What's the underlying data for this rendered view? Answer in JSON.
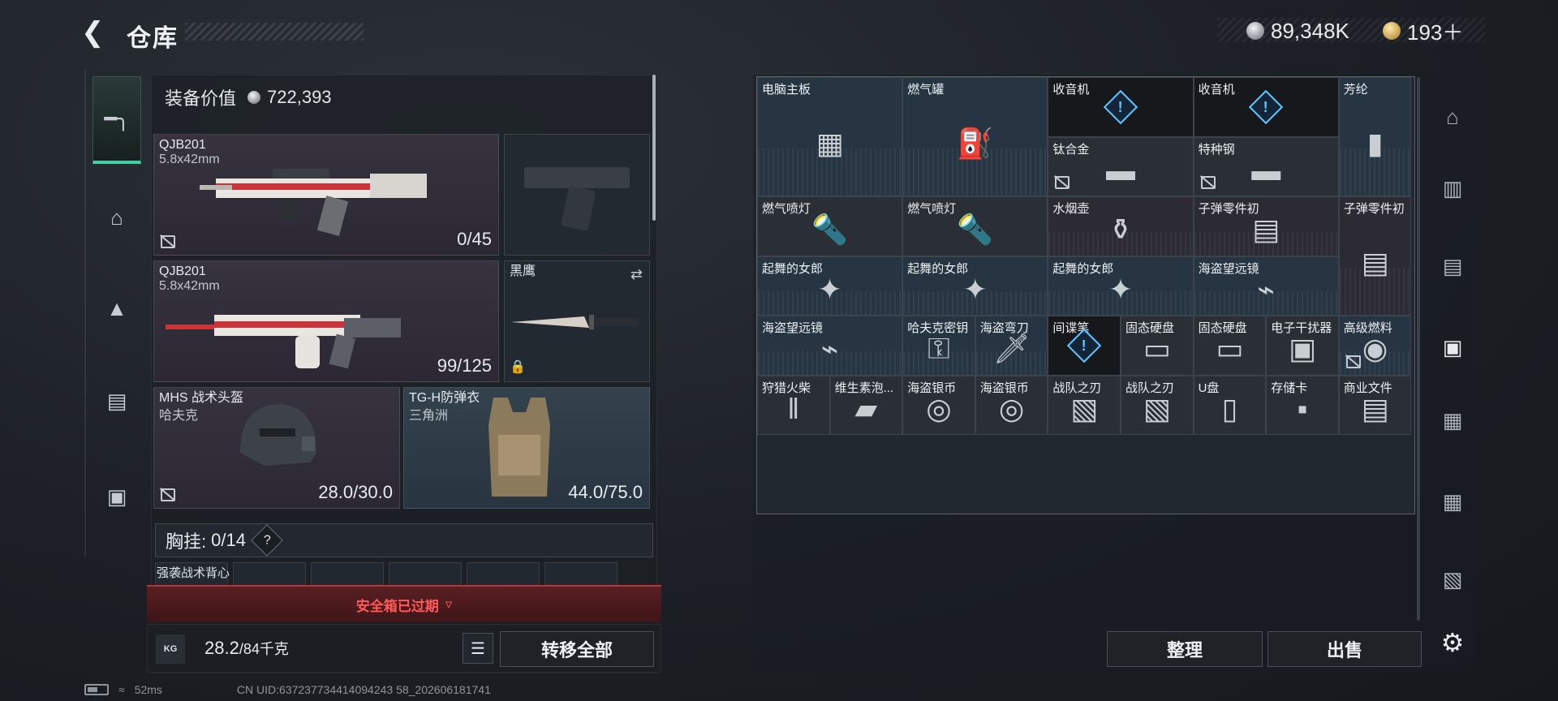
{
  "header": {
    "title": "仓库",
    "currency_silver": "89,348K",
    "currency_gold": "193＋"
  },
  "equipment": {
    "value_label": "装备价值",
    "value": "722,393",
    "primary": {
      "name": "QJB201",
      "caliber": "5.8x42mm",
      "ammo": "0/45"
    },
    "secondary": {
      "name": "QJB201",
      "caliber": "5.8x42mm",
      "ammo": "99/125"
    },
    "melee": {
      "name": "黑鹰"
    },
    "helmet": {
      "name": "MHS 战术头盔",
      "subtitle": "哈夫克",
      "durability": "28.0/30.0"
    },
    "armor": {
      "name": "TG-H防弹衣",
      "subtitle": "三角洲",
      "durability": "44.0/75.0"
    },
    "chest_rig": {
      "label": "胸挂:",
      "value": "0/14"
    },
    "vest": {
      "name": "强袭战术背心"
    },
    "safebox": "安全箱已过期",
    "weight": {
      "value": "28.2",
      "max": "/84千克"
    },
    "transfer_all": "转移全部"
  },
  "grid": [
    {
      "label": "电脑主板",
      "icon": "motherboard-icon",
      "glyph": "▦"
    },
    {
      "label": "燃气罐",
      "icon": "gas-canister-icon",
      "glyph": "⛽"
    },
    {
      "label": "收音机",
      "icon": "radio-icon",
      "glyph": "!"
    },
    {
      "label": "收音机",
      "icon": "radio-icon",
      "glyph": "!"
    },
    {
      "label": "芳纶",
      "icon": "aramid-roll-icon",
      "glyph": "▮"
    },
    {
      "label": "钛合金",
      "icon": "titanium-bar-icon",
      "glyph": "▬"
    },
    {
      "label": "特种钢",
      "icon": "steel-bar-icon",
      "glyph": "▬"
    },
    {
      "label": "燃气喷灯",
      "icon": "torch-icon",
      "glyph": "🔦"
    },
    {
      "label": "燃气喷灯",
      "icon": "torch-icon",
      "glyph": "🔦"
    },
    {
      "label": "水烟壶",
      "icon": "hookah-icon",
      "glyph": "⚱"
    },
    {
      "label": "子弹零件初",
      "icon": "ammo-parts-icon",
      "glyph": "▤"
    },
    {
      "label": "子弹零件初",
      "icon": "ammo-parts-icon",
      "glyph": "▤"
    },
    {
      "label": "起舞的女郎",
      "icon": "dancer-statue-icon",
      "glyph": "✦"
    },
    {
      "label": "起舞的女郎",
      "icon": "dancer-statue-icon",
      "glyph": "✦"
    },
    {
      "label": "起舞的女郎",
      "icon": "dancer-statue-icon",
      "glyph": "✦"
    },
    {
      "label": "海盗望远镜",
      "icon": "telescope-icon",
      "glyph": "⌁"
    },
    {
      "label": "海盗望远镜",
      "icon": "telescope-icon",
      "glyph": "⌁"
    },
    {
      "label": "哈夫克密钥",
      "icon": "key-icon",
      "glyph": "⚿"
    },
    {
      "label": "海盗弯刀",
      "icon": "dagger-icon",
      "glyph": "🗡"
    },
    {
      "label": "间谍笔",
      "icon": "spy-pen-icon",
      "glyph": "!"
    },
    {
      "label": "固态硬盘",
      "icon": "ssd-icon",
      "glyph": "▭"
    },
    {
      "label": "固态硬盘",
      "icon": "ssd-icon",
      "glyph": "▭"
    },
    {
      "label": "电子干扰器",
      "icon": "jammer-icon",
      "glyph": "▣"
    },
    {
      "label": "高级燃料",
      "icon": "fuel-can-icon",
      "glyph": "◉"
    },
    {
      "label": "狩猎火柴",
      "icon": "matches-icon",
      "glyph": "‖"
    },
    {
      "label": "维生素泡...",
      "icon": "vitamin-tube-icon",
      "glyph": "▰"
    },
    {
      "label": "海盗银币",
      "icon": "coin-icon",
      "glyph": "◎"
    },
    {
      "label": "海盗银币",
      "icon": "coin-icon",
      "glyph": "◎"
    },
    {
      "label": "战队之刃",
      "icon": "card-icon",
      "glyph": "▧"
    },
    {
      "label": "战队之刃",
      "icon": "card-icon",
      "glyph": "▧"
    },
    {
      "label": "U盘",
      "icon": "usb-drive-icon",
      "glyph": "▯"
    },
    {
      "label": "存储卡",
      "icon": "memory-card-icon",
      "glyph": "▪"
    },
    {
      "label": "商业文件",
      "icon": "documents-icon",
      "glyph": "▤"
    }
  ],
  "actions": {
    "sort": "整理",
    "sell": "出售"
  },
  "status": {
    "ping": "52ms",
    "uid": "CN UID:637237734414094243 58_202606181741"
  }
}
